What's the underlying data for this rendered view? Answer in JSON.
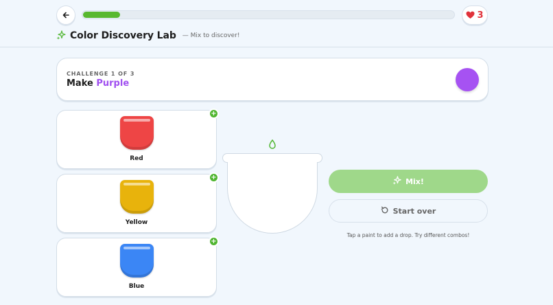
{
  "header": {
    "back_icon": "arrow-left-icon",
    "progress": 0.1,
    "lives": "3",
    "lives_icon": "heart-icon",
    "title_icon": "sparkle-icon",
    "title": "Color Discovery Lab",
    "subtitle": "— Mix to discover!"
  },
  "challenge": {
    "label": "CHALLENGE 1 OF 3",
    "prefix": "Make",
    "target": "Purple",
    "target_color": "#a04ff0",
    "swatch_color": "#a652f2"
  },
  "paints": [
    {
      "label": "Red",
      "color": "#ee4545"
    },
    {
      "label": "Yellow",
      "color": "#e8b30c"
    },
    {
      "label": "Blue",
      "color": "#3b86f5"
    }
  ],
  "add_badge_label": "+",
  "mixing_bowl": {
    "drop_icon": "drop-icon"
  },
  "actions": {
    "mix_label": "Mix!",
    "mix_icon": "sparkle-icon",
    "restart_label": "Start over",
    "restart_icon": "restart-icon"
  },
  "hint": "Tap a paint to add a drop. Try different combos!",
  "colors": {
    "accent_green": "#58b82f",
    "mix_button": "#9fd88a",
    "heart": "#e0323a"
  }
}
